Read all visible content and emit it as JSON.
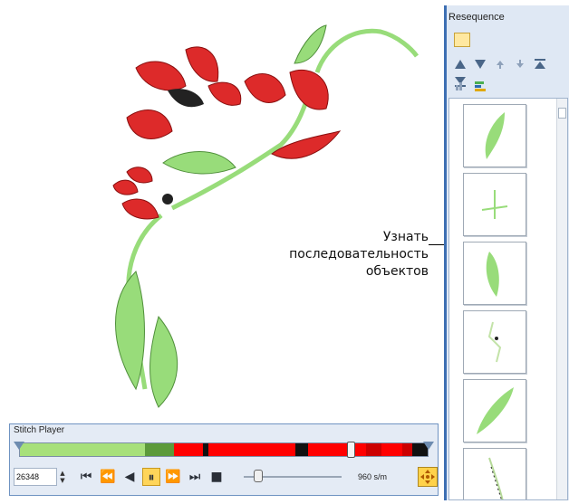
{
  "annotation": {
    "lines": [
      "Узнать",
      "последовательность",
      "объектов"
    ]
  },
  "resequence": {
    "title": "Resequence",
    "thumbnails": [
      {
        "name": "leaf-1"
      },
      {
        "name": "stem-1"
      },
      {
        "name": "leaf-2"
      },
      {
        "name": "stem-2"
      },
      {
        "name": "leaf-3"
      },
      {
        "name": "stem-3"
      }
    ],
    "toolbar_icons": [
      "move-up-icon",
      "move-down-icon",
      "move-up-one-icon",
      "move-down-one-icon",
      "move-to-top-icon",
      "move-to-bottom-icon"
    ],
    "sort_icons": [
      "sort-by-color-icon",
      "color-bars-icon"
    ]
  },
  "stitch_player": {
    "title": "Stitch Player",
    "stitch_count": "26348",
    "speed_label": "960 s/m",
    "progress_fraction": 0.81,
    "speed_fraction": 0.15,
    "timeline_segments": [
      {
        "color": "#a7e07a",
        "weight": 130
      },
      {
        "color": "#5c9a3a",
        "weight": 30
      },
      {
        "color": "#ff0000",
        "weight": 30
      },
      {
        "color": "#111111",
        "weight": 6
      },
      {
        "color": "#ff0000",
        "weight": 90
      },
      {
        "color": "#111111",
        "weight": 14
      },
      {
        "color": "#ff0000",
        "weight": 60
      },
      {
        "color": "#cc0000",
        "weight": 16
      },
      {
        "color": "#ff0000",
        "weight": 22
      },
      {
        "color": "#cc0000",
        "weight": 10
      },
      {
        "color": "#111111",
        "weight": 16
      }
    ]
  },
  "colors": {
    "petal_red": "#dd2a2a",
    "leaf_green": "#98dc7a",
    "dark_green": "#4f8f3a",
    "panel_blue": "#3d6fb3"
  }
}
